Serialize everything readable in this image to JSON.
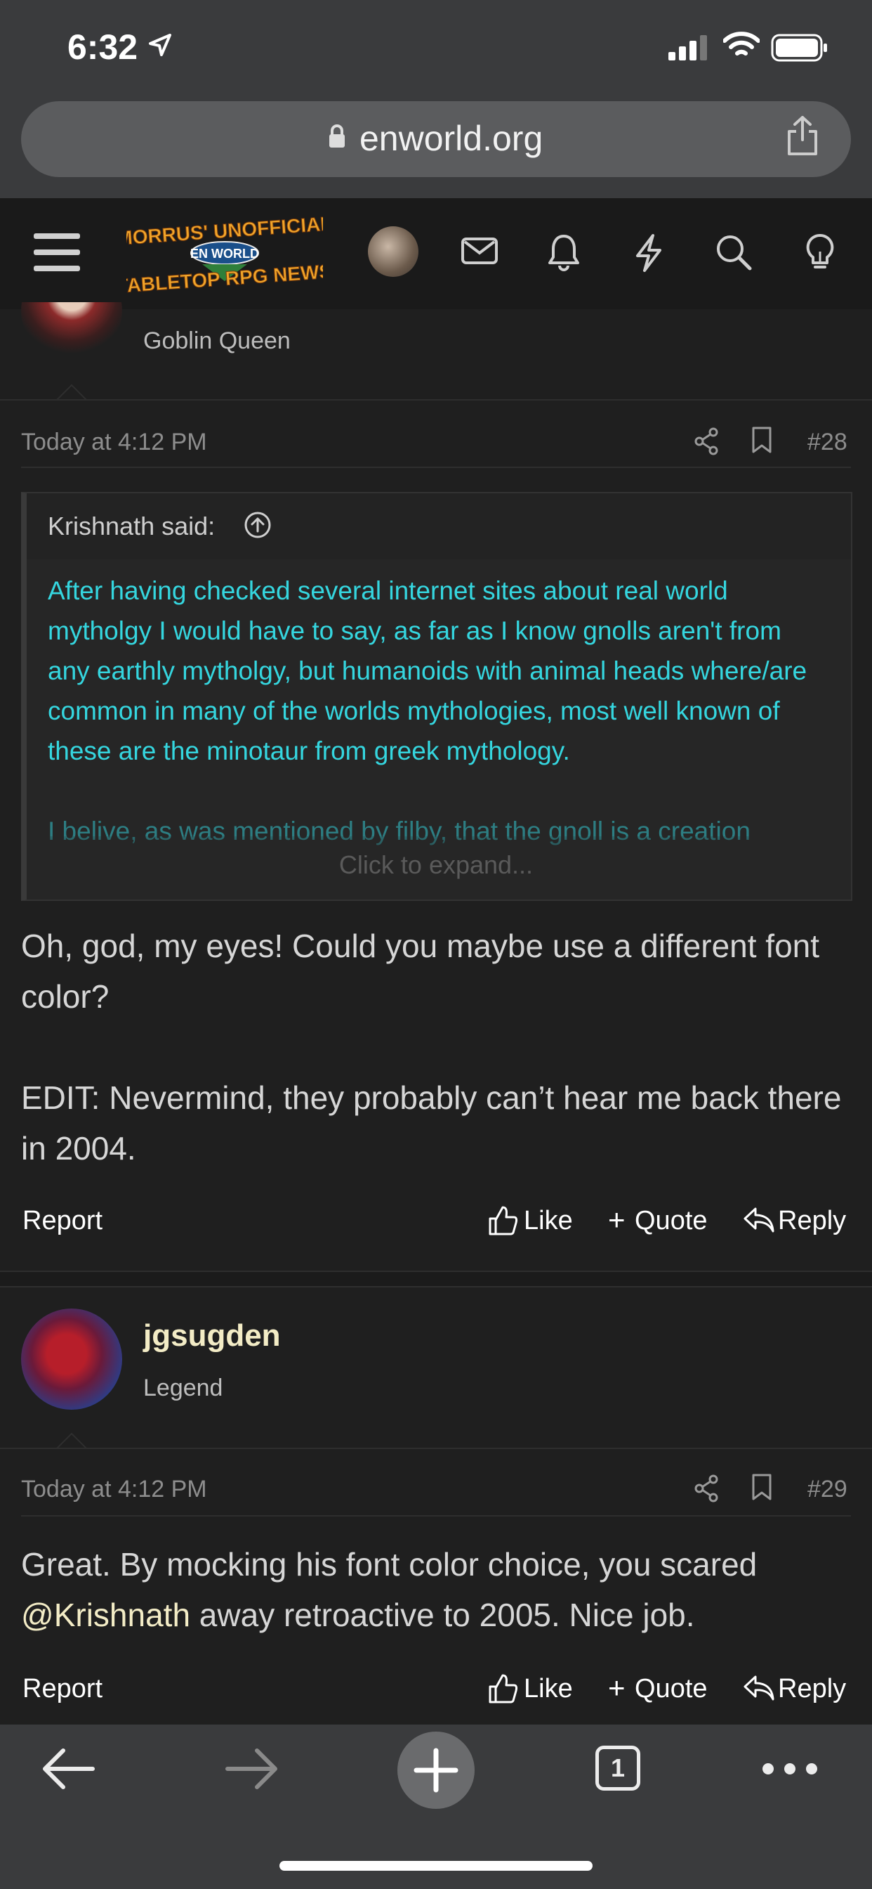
{
  "status": {
    "time": "6:32"
  },
  "browser": {
    "url": "enworld.org",
    "tab_count": "1"
  },
  "site": {
    "logo_line1": "MORRUS' UNOFFICIAL",
    "logo_line2": "EN WORLD",
    "logo_line3": "TABLETOP RPG NEWS"
  },
  "post28": {
    "user_title": "Goblin Queen",
    "timestamp": "Today at 4:12 PM",
    "number": "#28",
    "quote": {
      "author": "Krishnath said:",
      "paragraph1": "After having checked several internet sites about real world mytholgy I would have to say, as far as I know gnolls aren't from any earthly mytholgy, but humanoids with animal heads where/are common in many of the worlds mythologies, most well known of these are the minotaur from greek mythology.",
      "paragraph2": "I belive, as was mentioned by filby, that the gnoll is a creation",
      "expand": "Click to expand..."
    },
    "body1": "Oh, god, my eyes! Could you maybe use a different font color?",
    "body2": "EDIT: Nevermind, they probably can’t hear me back there in 2004.",
    "actions": {
      "report": "Report",
      "like": "Like",
      "quote": "Quote",
      "reply": "Reply"
    }
  },
  "post29": {
    "username": "jgsugden",
    "user_title": "Legend",
    "timestamp": "Today at 4:12 PM",
    "number": "#29",
    "body_part1": "Great. By mocking his font color choice, you scared ",
    "mention": "@Krishnath",
    "body_part2": " away retroactive to 2005. Nice job.",
    "actions": {
      "report": "Report",
      "like": "Like",
      "quote": "Quote",
      "reply": "Reply"
    }
  },
  "colors": {
    "accent_username": "#f3ecc6",
    "quote_text": "#35d6df",
    "background": "#1f1f1f"
  }
}
